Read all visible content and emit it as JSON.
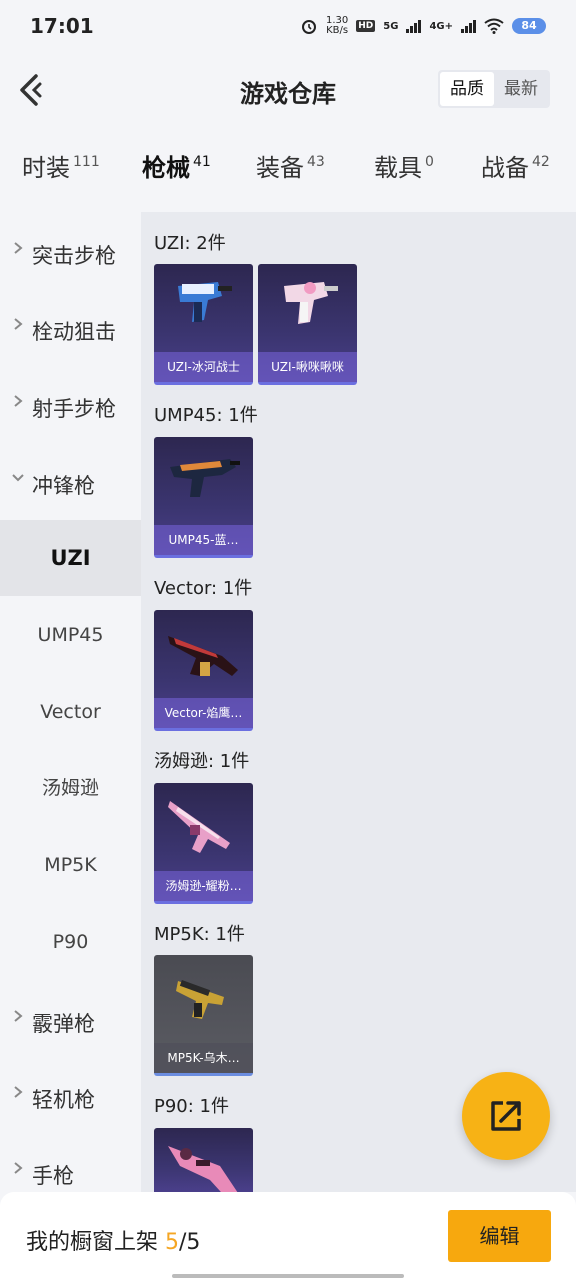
{
  "status": {
    "time": "17:01",
    "speed_top": "1.30",
    "speed_unit": "KB/s",
    "hd_label": "HD",
    "net_5g": "5G",
    "net_4g": "4G+",
    "battery": "84"
  },
  "header": {
    "title": "游戏仓库",
    "sort_quality": "品质",
    "sort_newest": "最新"
  },
  "tabs": [
    {
      "label": "时装",
      "count": "111"
    },
    {
      "label": "枪械",
      "count": "41"
    },
    {
      "label": "装备",
      "count": "43"
    },
    {
      "label": "载具",
      "count": "0"
    },
    {
      "label": "战备",
      "count": "42"
    }
  ],
  "sidebar": {
    "categories": [
      "突击步枪",
      "栓动狙击",
      "射手步枪",
      "冲锋枪",
      "霰弹枪",
      "轻机枪",
      "手枪"
    ],
    "sub_items": [
      "UZI",
      "UMP45",
      "Vector",
      "汤姆逊",
      "MP5K",
      "P90"
    ]
  },
  "groups": [
    {
      "title": "UZI: 2件",
      "items": [
        "UZI-冰河战士",
        "UZI-啾咪啾咪"
      ]
    },
    {
      "title": "UMP45: 1件",
      "items": [
        "UMP45-蓝…"
      ]
    },
    {
      "title": "Vector: 1件",
      "items": [
        "Vector-焰鹰…"
      ]
    },
    {
      "title": "汤姆逊: 1件",
      "items": [
        "汤姆逊-耀粉…"
      ]
    },
    {
      "title": "MP5K: 1件",
      "items": [
        "MP5K-乌木…"
      ]
    },
    {
      "title": "P90: 1件",
      "items": []
    }
  ],
  "bottom": {
    "prefix": "我的橱窗上架 ",
    "current": "5",
    "separator": "/",
    "total": "5",
    "edit_label": "编辑"
  },
  "colors": {
    "accent": "#f7a80e",
    "card_bg": "#2d2750",
    "count_highlight": "#f5a623"
  },
  "icons": {
    "back": "back-arrow-icon",
    "share": "share-export-icon",
    "chevron": "chevron-right-icon"
  }
}
